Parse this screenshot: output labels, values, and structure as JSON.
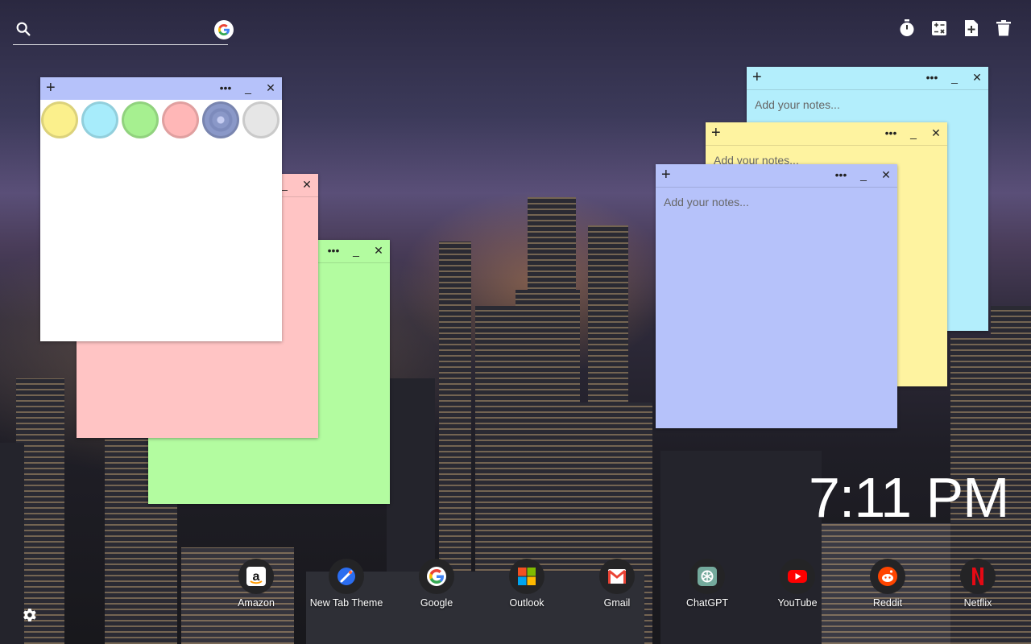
{
  "search": {
    "placeholder": ""
  },
  "toolbar": {
    "items": [
      "timer-icon",
      "calculator-icon",
      "new-note-icon",
      "trash-icon"
    ]
  },
  "notes": {
    "placeholder": "Add your notes...",
    "colors": {
      "white": "#ffffff",
      "pink": "#ffc4c4",
      "green": "#b3fca0",
      "blue": "#b6c2fa",
      "yellow": "#fef3a0",
      "cyan": "#b3eefc"
    }
  },
  "palette": [
    "#fbf08c",
    "#a7ecfb",
    "#a6f090",
    "#ffb7b7",
    "#8a98c8",
    "#e6e6e6"
  ],
  "clock": {
    "time": "7:11 PM"
  },
  "dock": {
    "apps": [
      {
        "label": "Amazon",
        "icon": "amazon-icon"
      },
      {
        "label": "New Tab Theme",
        "icon": "new-tab-theme-icon"
      },
      {
        "label": "Google",
        "icon": "google-icon"
      },
      {
        "label": "Outlook",
        "icon": "outlook-icon"
      },
      {
        "label": "Gmail",
        "icon": "gmail-icon"
      },
      {
        "label": "ChatGPT",
        "icon": "chatgpt-icon"
      },
      {
        "label": "YouTube",
        "icon": "youtube-icon"
      },
      {
        "label": "Reddit",
        "icon": "reddit-icon"
      },
      {
        "label": "Netflix",
        "icon": "netflix-icon"
      }
    ]
  }
}
